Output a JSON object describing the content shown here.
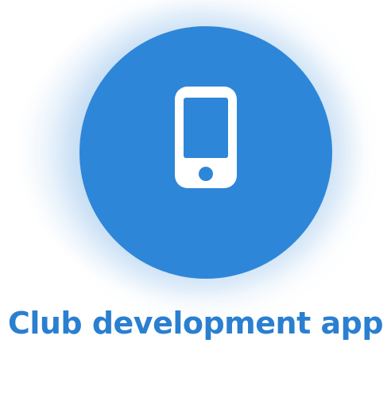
{
  "card": {
    "title": "Club development app",
    "icon": "smartphone-icon",
    "accent_color": "#2e86d8",
    "title_color": "#2a7fd0"
  }
}
